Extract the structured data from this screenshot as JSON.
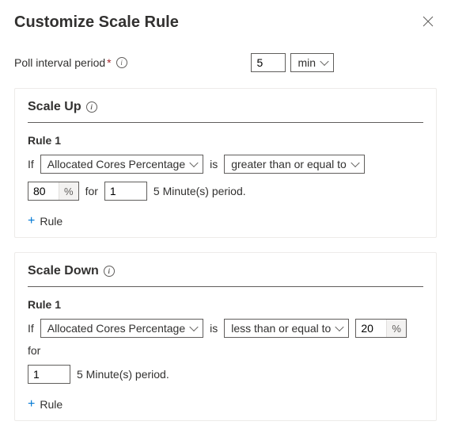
{
  "title": "Customize Scale Rule",
  "pollInterval": {
    "label": "Poll interval period",
    "value": "5",
    "unit": "min"
  },
  "scaleUp": {
    "title": "Scale Up",
    "rule": {
      "title": "Rule 1",
      "ifLabel": "If",
      "metric": "Allocated Cores Percentage",
      "isLabel": "is",
      "operator": "greater than or equal to",
      "threshold": "80",
      "forLabel": "for",
      "periodCount": "1",
      "periodText": "5 Minute(s) period."
    },
    "addRule": "Rule"
  },
  "scaleDown": {
    "title": "Scale Down",
    "rule": {
      "title": "Rule 1",
      "ifLabel": "If",
      "metric": "Allocated Cores Percentage",
      "isLabel": "is",
      "operator": "less than or equal to",
      "threshold": "20",
      "forLabel": "for",
      "periodCount": "1",
      "periodText": "5 Minute(s) period."
    },
    "addRule": "Rule"
  },
  "percentSymbol": "%"
}
